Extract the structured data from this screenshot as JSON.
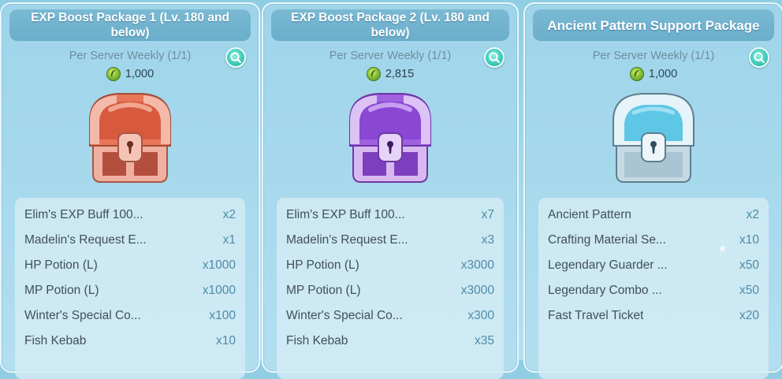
{
  "packages": [
    {
      "title": "EXP Boost Package 1 (Lv. 180 and below)",
      "limit": "Per Server Weekly (1/1)",
      "price": "1,000",
      "items": [
        {
          "name": "Elim's EXP Buff 100...",
          "qty": "x2"
        },
        {
          "name": "Madelin's Request E...",
          "qty": "x1"
        },
        {
          "name": "HP Potion (L)",
          "qty": "x1000"
        },
        {
          "name": "MP Potion (L)",
          "qty": "x1000"
        },
        {
          "name": "Winter's Special Co...",
          "qty": "x100"
        },
        {
          "name": "Fish Kebab",
          "qty": "x10"
        }
      ]
    },
    {
      "title": "EXP Boost Package 2 (Lv. 180 and below)",
      "limit": "Per Server Weekly (1/1)",
      "price": "2,815",
      "items": [
        {
          "name": "Elim's EXP Buff 100...",
          "qty": "x7"
        },
        {
          "name": "Madelin's Request E...",
          "qty": "x3"
        },
        {
          "name": "HP Potion (L)",
          "qty": "x3000"
        },
        {
          "name": "MP Potion (L)",
          "qty": "x3000"
        },
        {
          "name": "Winter's Special Co...",
          "qty": "x300"
        },
        {
          "name": "Fish Kebab",
          "qty": "x35"
        }
      ]
    },
    {
      "title": "Ancient Pattern Support Package",
      "limit": "Per Server Weekly (1/1)",
      "price": "1,000",
      "items": [
        {
          "name": "Ancient Pattern",
          "qty": "x2"
        },
        {
          "name": "Crafting Material Se...",
          "qty": "x10"
        },
        {
          "name": "Legendary Guarder ...",
          "qty": "x50"
        },
        {
          "name": "Legendary Combo ...",
          "qty": "x50"
        },
        {
          "name": "Fast Travel Ticket",
          "qty": "x20"
        }
      ]
    }
  ],
  "colors": {
    "chest_1": "#e8775a",
    "chest_2": "#a061df",
    "chest_3": "#5ec7e6",
    "currency": "#8cc13a",
    "zoom_button": "#3cc7b8"
  },
  "icons": {
    "currency": "green-gem-coin-icon",
    "zoom": "magnifier-icon",
    "chest": "treasure-chest-icon"
  }
}
